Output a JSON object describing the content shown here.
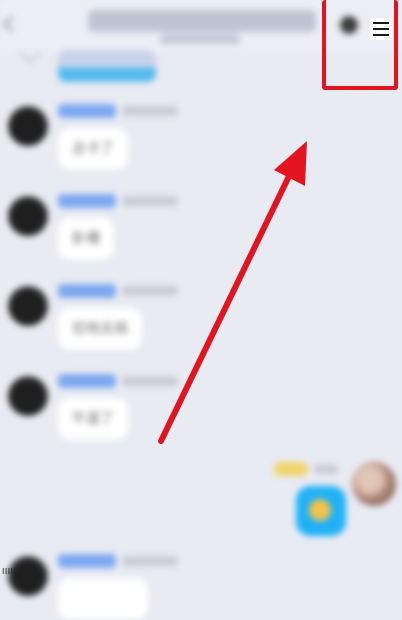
{
  "header": {
    "menu_icon": "hamburger-menu-icon",
    "back_icon": "chevron-left-icon"
  },
  "messages": [
    {
      "direction": "incoming",
      "text": "总卡了"
    },
    {
      "direction": "incoming",
      "text": "卧槽"
    },
    {
      "direction": "incoming",
      "text": "怼他去搞"
    },
    {
      "direction": "incoming",
      "text": "牛逼了"
    },
    {
      "direction": "outgoing",
      "icon": "emoji-icon"
    }
  ],
  "footer": {
    "corner_label": "IIIIlZr"
  },
  "annotation": {
    "color": "#e3141f",
    "arrow_icon": "red-arrow-icon"
  }
}
